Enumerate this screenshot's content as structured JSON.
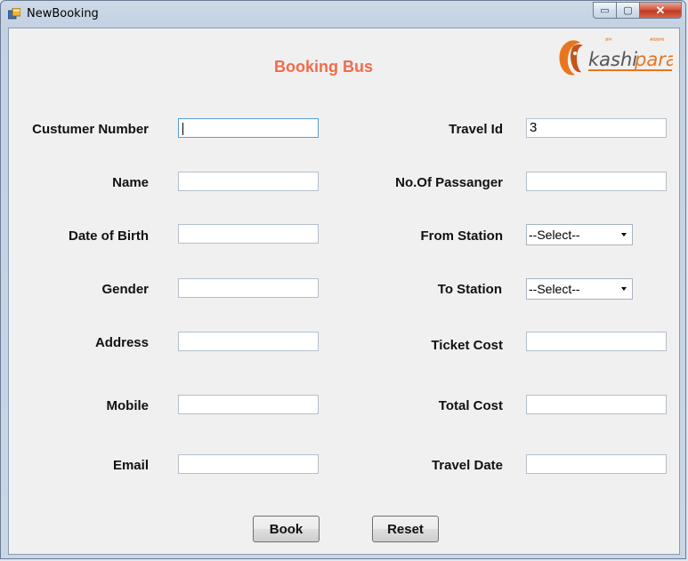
{
  "window": {
    "title": "NewBooking",
    "controls": {
      "minimize": "▭",
      "maximize": "▢",
      "close": "✕"
    }
  },
  "form": {
    "heading": "Booking Bus",
    "logo_text": "kashipara",
    "logo_small_left": "ज्ञान",
    "logo_small_right": "संग्रहालय",
    "left": [
      {
        "label": "Custumer Number",
        "value": ""
      },
      {
        "label": "Name",
        "value": ""
      },
      {
        "label": "Date of Birth",
        "value": ""
      },
      {
        "label": "Gender",
        "value": ""
      },
      {
        "label": "Address",
        "value": ""
      },
      {
        "label": "Mobile",
        "value": ""
      },
      {
        "label": "Email",
        "value": ""
      }
    ],
    "right": {
      "travel_id": {
        "label": "Travel Id",
        "value": "3"
      },
      "passengers": {
        "label": "No.Of Passanger",
        "value": ""
      },
      "from_station": {
        "label": "From Station",
        "selected": "--Select--"
      },
      "to_station": {
        "label": "To Station",
        "selected": "--Select--"
      },
      "ticket_cost": {
        "label": "Ticket Cost",
        "value": ""
      },
      "total_cost": {
        "label": "Total Cost",
        "value": ""
      },
      "travel_date": {
        "label": "Travel Date",
        "value": ""
      }
    },
    "buttons": {
      "book": "Book",
      "reset": "Reset"
    }
  },
  "colors": {
    "heading": "#f26b4a",
    "logo_orange": "#e8761f",
    "logo_text": "#555555"
  }
}
